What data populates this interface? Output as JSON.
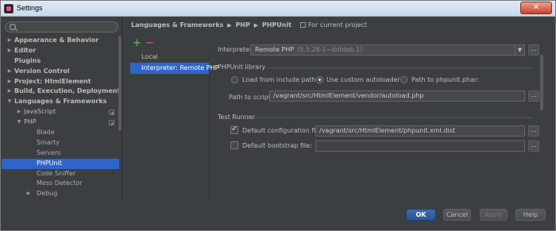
{
  "window": {
    "title": "Settings",
    "close_label": "✕"
  },
  "search": {
    "placeholder": ""
  },
  "tree": [
    {
      "label": "Appearance & Behavior",
      "bold": true,
      "expanded": false,
      "depth": 0
    },
    {
      "label": "Editor",
      "bold": true,
      "expanded": false,
      "depth": 0
    },
    {
      "label": "Plugins",
      "bold": true,
      "expanded": null,
      "depth": 0
    },
    {
      "label": "Version Control",
      "bold": true,
      "expanded": false,
      "depth": 0
    },
    {
      "label": "Project: HtmlElement",
      "bold": true,
      "expanded": false,
      "depth": 0
    },
    {
      "label": "Build, Execution, Deployment",
      "bold": true,
      "expanded": false,
      "depth": 0
    },
    {
      "label": "Languages & Frameworks",
      "bold": true,
      "expanded": true,
      "depth": 0
    },
    {
      "label": "JavaScript",
      "bold": false,
      "expanded": false,
      "depth": 1,
      "project_icon": true
    },
    {
      "label": "PHP",
      "bold": false,
      "expanded": true,
      "depth": 1,
      "project_icon": true
    },
    {
      "label": "Blade",
      "bold": false,
      "expanded": null,
      "depth": 2
    },
    {
      "label": "Smarty",
      "bold": false,
      "expanded": null,
      "depth": 2
    },
    {
      "label": "Servers",
      "bold": false,
      "expanded": null,
      "depth": 2
    },
    {
      "label": "PHPUnit",
      "bold": false,
      "expanded": null,
      "depth": 2,
      "selected": true
    },
    {
      "label": "Code Sniffer",
      "bold": false,
      "expanded": null,
      "depth": 2
    },
    {
      "label": "Mess Detector",
      "bold": false,
      "expanded": null,
      "depth": 2
    },
    {
      "label": "Debug",
      "bold": false,
      "expanded": false,
      "depth": 2
    }
  ],
  "breadcrumb": {
    "parts": [
      "Languages & Frameworks",
      "PHP",
      "PHPUnit"
    ],
    "scope": "For current project"
  },
  "interpreters": {
    "add_label": "+",
    "remove_label": "−",
    "items": [
      {
        "label": "Local",
        "selected": false
      },
      {
        "label": "Interpreter: Remote PHP",
        "selected": true
      }
    ]
  },
  "interpreter_field": {
    "label": "Interpreter:",
    "value": "Remote PHP",
    "hint": "(5.5.28-1~dotdeb.1)"
  },
  "library": {
    "title": "PHPUnit library",
    "options": [
      {
        "label": "Load from include path",
        "checked": false
      },
      {
        "label": "Use custom autoloader",
        "checked": true
      },
      {
        "label": "Path to phpunit.phar:",
        "checked": false
      }
    ],
    "script_label": "Path to script:",
    "script_value": "/vagrant/src/HtmlElement/vendor/autoload.php"
  },
  "runner": {
    "title": "Test Runner",
    "config_label": "Default configuration file:",
    "config_checked": true,
    "config_value": "/vagrant/src/HtmlElement/phpunit.xml.dist",
    "bootstrap_label": "Default bootstrap file:",
    "bootstrap_checked": false,
    "bootstrap_value": ""
  },
  "dots_label": "...",
  "buttons": {
    "ok": "OK",
    "cancel": "Cancel",
    "apply": "Apply",
    "help": "Help"
  }
}
